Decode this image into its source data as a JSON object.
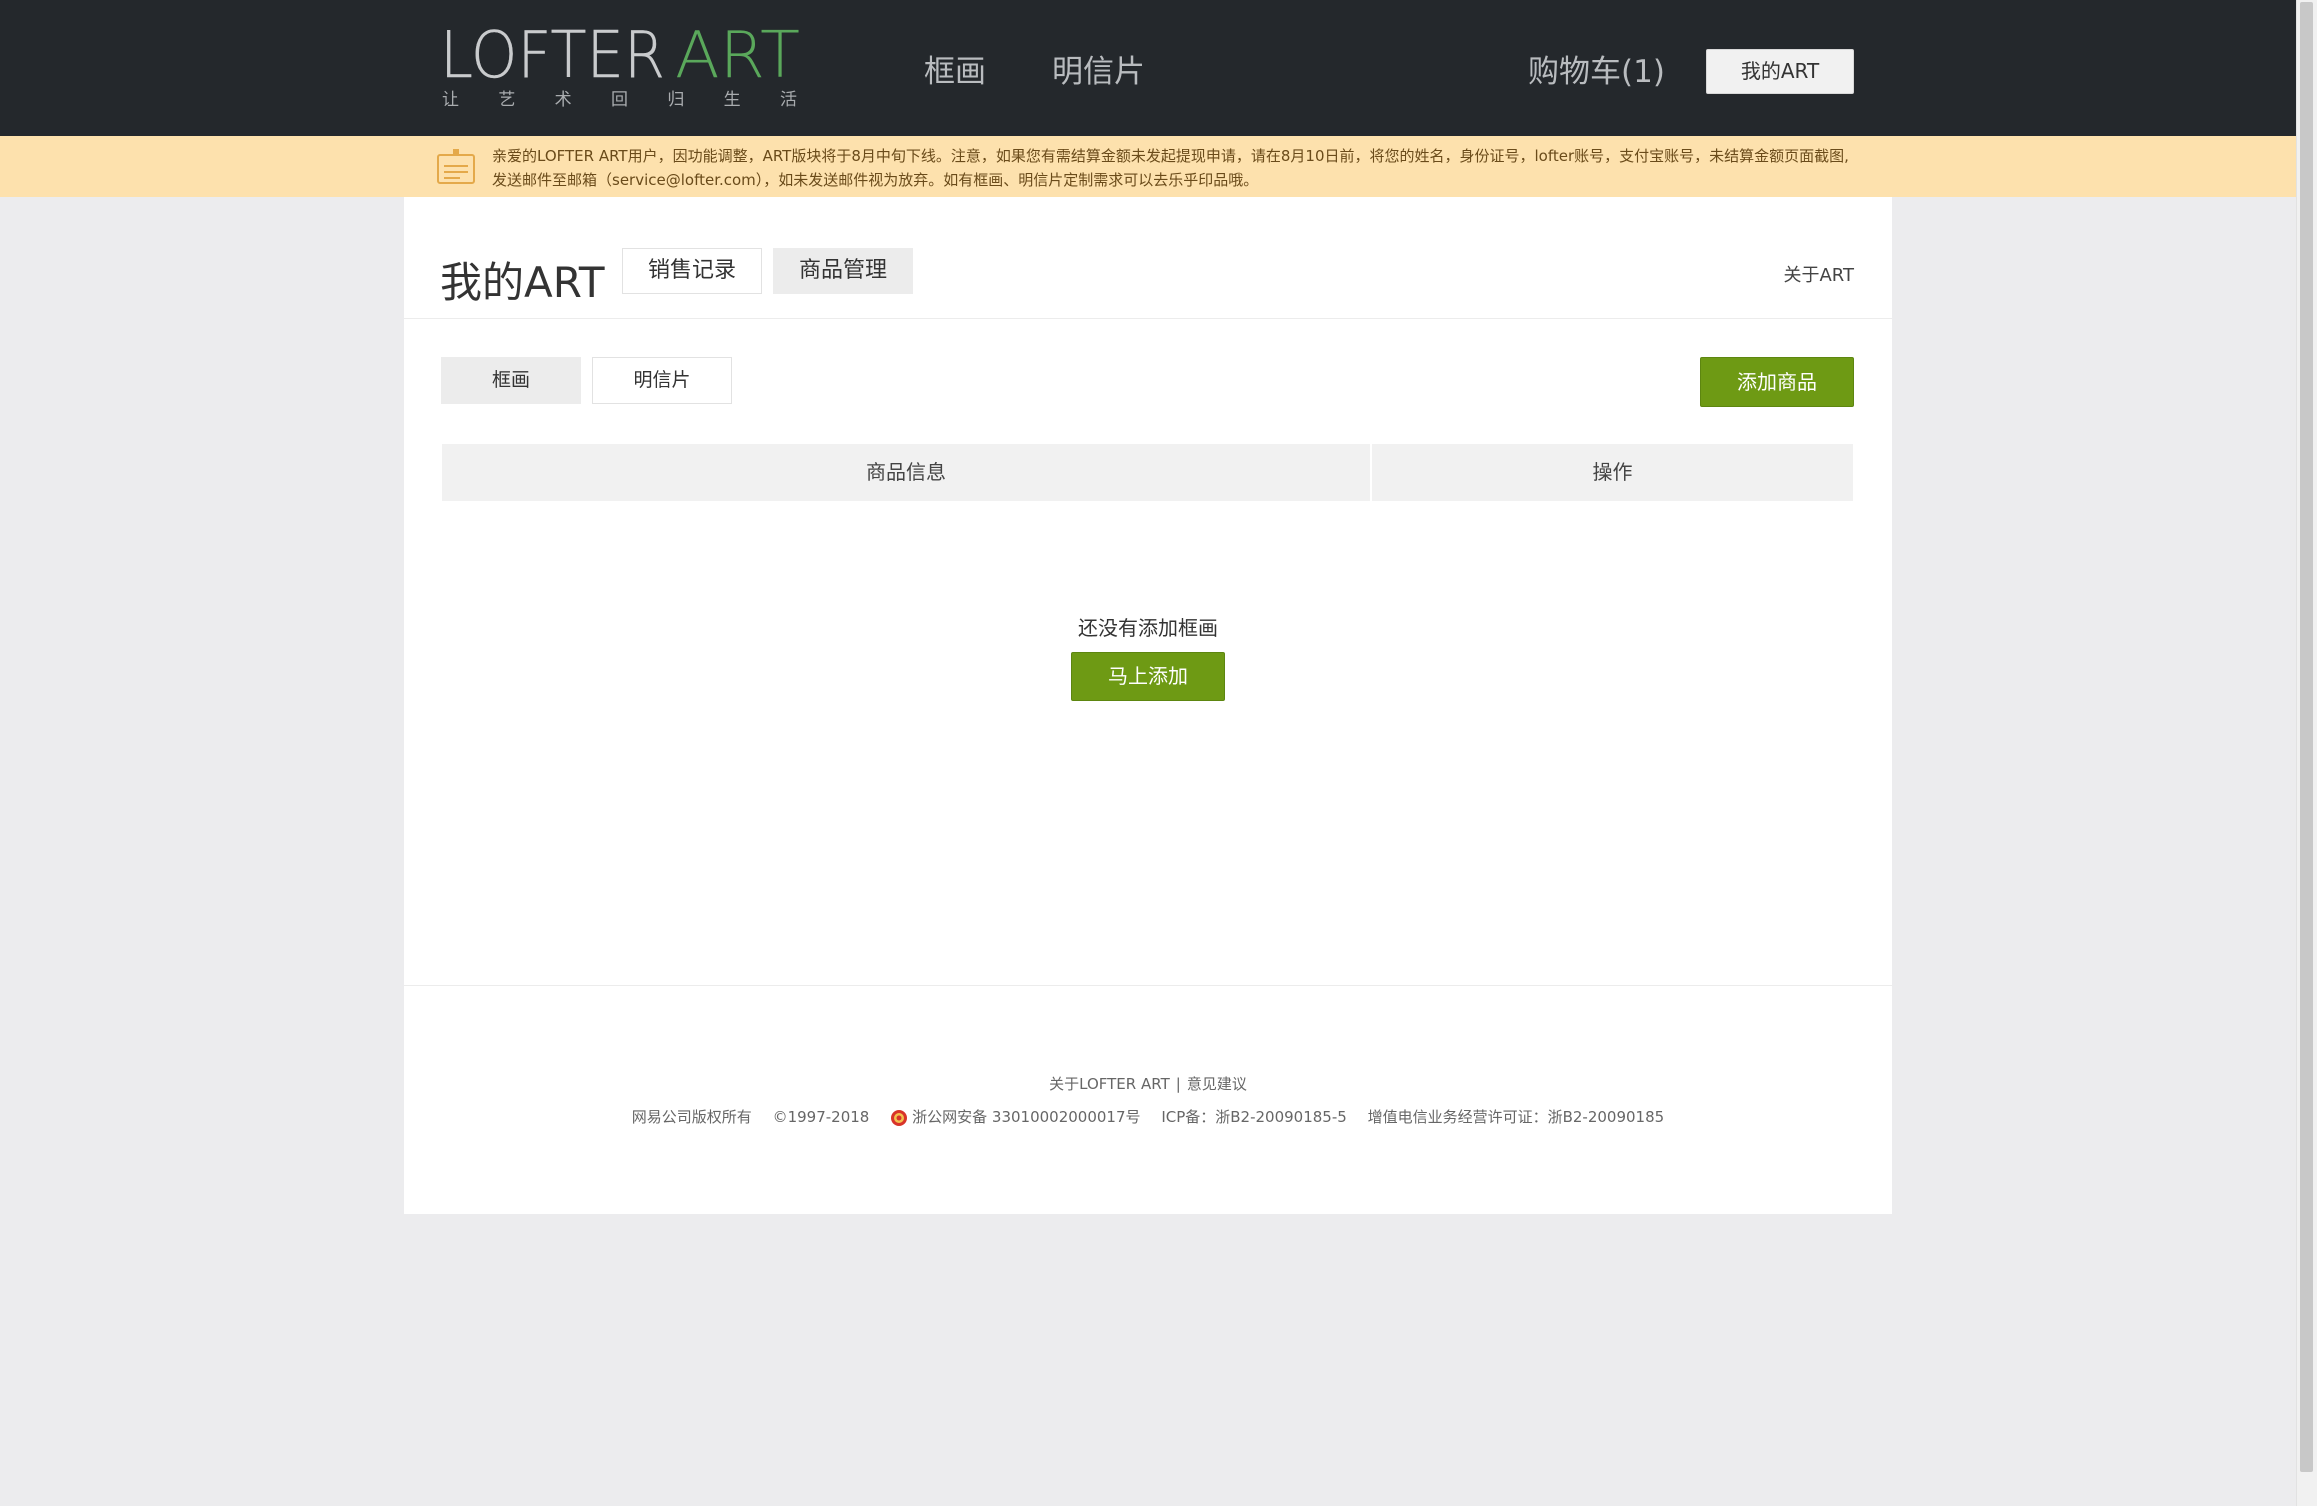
{
  "header": {
    "logo_word_primary": "LOFTER",
    "logo_word_accent": "ART",
    "logo_tagline": "让 艺 术 回 归 生 活",
    "nav": [
      "框画",
      "明信片"
    ],
    "cart_label": "购物车(1)",
    "my_art_button": "我的ART"
  },
  "notice": {
    "line1": "亲爱的LOFTER ART用户，因功能调整，ART版块将于8月中旬下线。注意，如果您有需结算金额未发起提现申请，请在8月10日前，将您的姓名，身份证号，lofter账号，支付宝账号，未结算金额页面截图,",
    "line2": "发送邮件至邮箱（service@lofter.com），如未发送邮件视为放弃。如有框画、明信片定制需求可以去乐乎印品哦。"
  },
  "main": {
    "title": "我的ART",
    "tabs": [
      "销售记录",
      "商品管理"
    ],
    "about_link": "关于ART",
    "subtabs": [
      "框画",
      "明信片"
    ],
    "add_goods_button": "添加商品",
    "table_headers": [
      "商品信息",
      "操作"
    ],
    "empty_message": "还没有添加框画",
    "add_now_button": "马上添加"
  },
  "footer": {
    "about_link": "关于LOFTER ART",
    "separator": "|",
    "feedback_link": "意见建议",
    "copyright": "网易公司版权所有",
    "years": "©1997-2018",
    "police_record": "浙公网安备 33010002000017号",
    "icp": "ICP备：浙B2-20090185-5",
    "license": "增值电信业务经营许可证：浙B2-20090185"
  },
  "colors": {
    "header_bg": "#24282c",
    "notice_bg": "#fde1ad",
    "accent_green": "#6e9a14",
    "page_bg": "#ececee"
  }
}
